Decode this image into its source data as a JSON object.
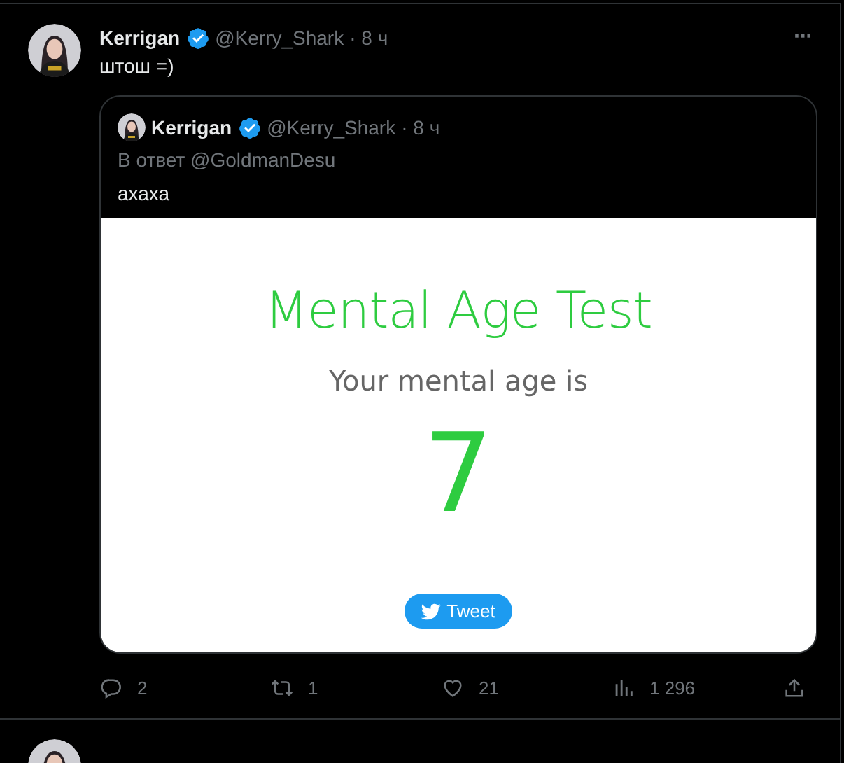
{
  "tweets": [
    {
      "author": {
        "name": "Kerrigan",
        "verified": true,
        "handle": "@Kerry_Shark",
        "time": "· 8 ч"
      },
      "more": "···",
      "text": "штош =)",
      "quote": {
        "author": {
          "name": "Kerrigan",
          "verified": true,
          "handle": "@Kerry_Shark",
          "time": "· 8 ч"
        },
        "reply_to": "В ответ @GoldmanDesu",
        "text": "ахаха",
        "card": {
          "title": "Mental Age Test",
          "subtitle": "Your mental age is",
          "result": "7",
          "button": "Tweet"
        }
      },
      "actions": [
        {
          "kind": "reply",
          "count": "2"
        },
        {
          "kind": "retweet",
          "count": "1"
        },
        {
          "kind": "like",
          "count": "21"
        },
        {
          "kind": "views",
          "count": "1 296"
        },
        {
          "kind": "share"
        }
      ]
    }
  ]
}
